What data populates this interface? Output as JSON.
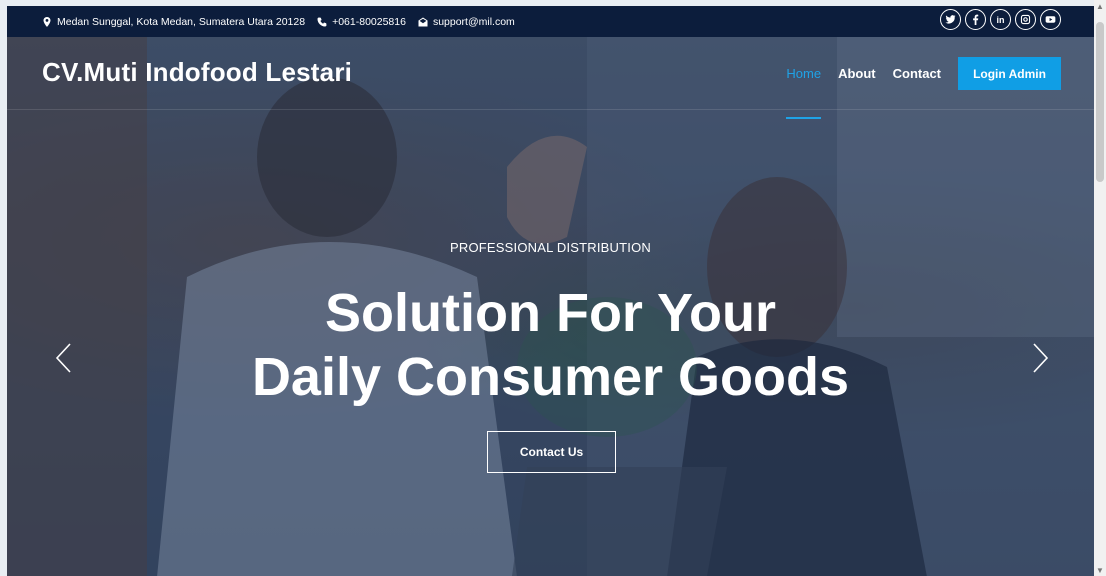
{
  "topbar": {
    "address": "Medan Sunggal, Kota Medan, Sumatera Utara 20128",
    "phone": "+061-80025816",
    "email": "support@mil.com",
    "socials": [
      "twitter-icon",
      "facebook-icon",
      "linkedin-icon",
      "instagram-icon",
      "youtube-icon"
    ],
    "linkedin_text": "in"
  },
  "nav": {
    "brand": "CV.Muti Indofood Lestari",
    "items": [
      {
        "label": "Home",
        "active": true
      },
      {
        "label": "About",
        "active": false
      },
      {
        "label": "Contact",
        "active": false
      }
    ],
    "login_label": "Login Admin"
  },
  "hero": {
    "kicker": "PROFESSIONAL DISTRIBUTION",
    "headline_line1": "Solution For Your",
    "headline_line2": "Daily Consumer Goods",
    "cta_label": "Contact Us"
  },
  "colors": {
    "topbar_bg": "#0c1d3c",
    "accent": "#109ee5"
  }
}
